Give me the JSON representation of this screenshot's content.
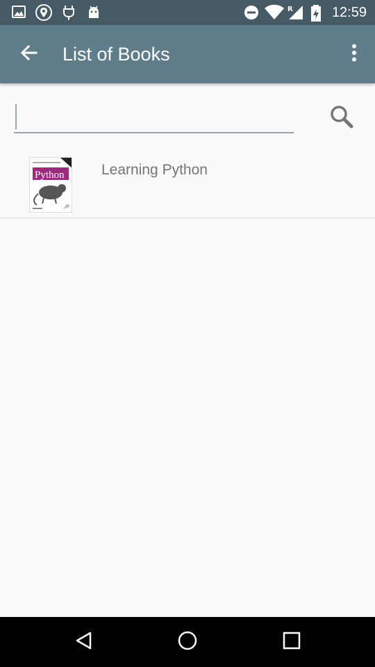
{
  "status_bar": {
    "time": "12:59",
    "icons": [
      "gallery-icon",
      "location-shield-icon",
      "plug-icon",
      "android-icon",
      "do-not-disturb-icon",
      "wifi-icon",
      "signal-roaming-icon",
      "battery-charging-icon"
    ]
  },
  "app_bar": {
    "title": "List of Books",
    "back_icon": "arrow-back-icon",
    "overflow_icon": "more-vert-icon"
  },
  "search": {
    "value": "",
    "placeholder": "",
    "button_icon": "search-icon"
  },
  "books": [
    {
      "title": "Learning Python",
      "cover_text": "Python"
    }
  ],
  "nav_bar": {
    "back_icon": "nav-back-icon",
    "home_icon": "nav-home-icon",
    "recents_icon": "nav-recents-icon"
  },
  "colors": {
    "status_bar": "#455a64",
    "app_bar": "#607d8b",
    "accent": "#90a4ae",
    "cover_band": "#9c2a7e"
  }
}
